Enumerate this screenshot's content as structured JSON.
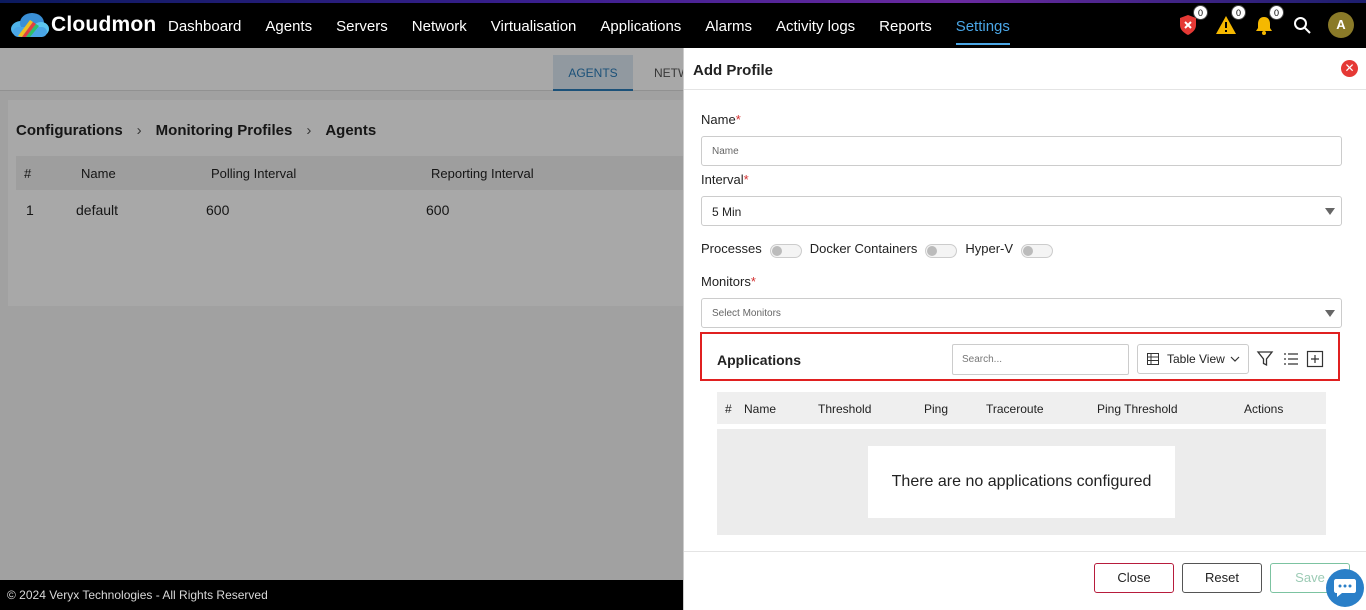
{
  "app": {
    "name": "Cloudmon"
  },
  "nav": {
    "items": [
      {
        "label": "Dashboard"
      },
      {
        "label": "Agents"
      },
      {
        "label": "Servers"
      },
      {
        "label": "Network"
      },
      {
        "label": "Virtualisation"
      },
      {
        "label": "Applications"
      },
      {
        "label": "Alarms"
      },
      {
        "label": "Activity logs"
      },
      {
        "label": "Reports"
      },
      {
        "label": "Settings",
        "active": true
      }
    ],
    "badges": {
      "critical": "0",
      "warning": "0",
      "notifications": "0"
    },
    "avatar_initial": "A"
  },
  "background": {
    "tabs": {
      "active": "AGENTS",
      "partial": "NETW"
    },
    "breadcrumb": [
      "Configurations",
      "Monitoring Profiles",
      "Agents"
    ],
    "table": {
      "headers": [
        "#",
        "Name",
        "Polling Interval",
        "Reporting Interval"
      ],
      "rows": [
        {
          "num": "1",
          "name": "default",
          "polling": "600",
          "reporting": "600"
        }
      ]
    }
  },
  "footer": {
    "copyright": "© 2024 Veryx Technologies - All Rights Reserved"
  },
  "drawer": {
    "title": "Add Profile",
    "close_glyph": "✕",
    "name": {
      "label": "Name",
      "required_mark": "*",
      "placeholder": "Name"
    },
    "interval": {
      "label": "Interval",
      "required_mark": "*",
      "value": "5 Min"
    },
    "toggles": {
      "processes": "Processes",
      "docker": "Docker Containers",
      "hyperv": "Hyper-V"
    },
    "monitors": {
      "label": "Monitors",
      "required_mark": "*",
      "placeholder": "Select Monitors"
    },
    "applications": {
      "title": "Applications",
      "search_placeholder": "Search...",
      "view": "Table View",
      "headers": [
        "#",
        "Name",
        "Threshold",
        "Ping",
        "Traceroute",
        "Ping Threshold",
        "Actions"
      ],
      "empty_message": "There are no applications configured"
    },
    "buttons": {
      "close": "Close",
      "reset": "Reset",
      "save": "Save"
    }
  },
  "colors": {
    "accent": "#4aa6e6",
    "danger": "#e53935",
    "highlight_border": "#e02020",
    "save_border": "#7cc3a1"
  },
  "icons": [
    "cloud-logo-icon",
    "shield-alert-icon",
    "warning-icon",
    "bell-icon",
    "search-icon",
    "filter-icon",
    "list-icon",
    "add-icon",
    "chat-icon",
    "close-icon",
    "chevron-down-icon",
    "table-icon"
  ]
}
